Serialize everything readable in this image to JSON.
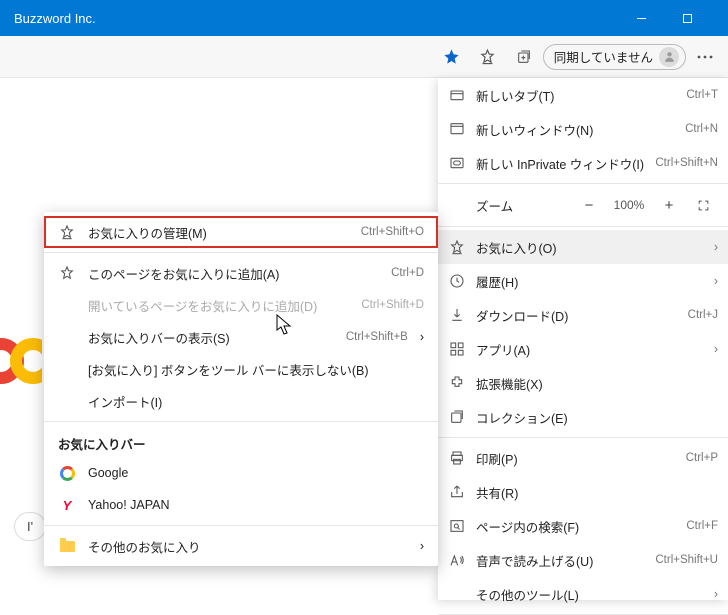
{
  "window": {
    "title": "Buzzword Inc."
  },
  "toolbar": {
    "sync_label": "同期していません"
  },
  "zoom": {
    "label": "ズーム",
    "value": "100%"
  },
  "menu": {
    "new_tab": {
      "label": "新しいタブ(T)",
      "shortcut": "Ctrl+T"
    },
    "new_window": {
      "label": "新しいウィンドウ(N)",
      "shortcut": "Ctrl+N"
    },
    "new_inprivate": {
      "label": "新しい InPrivate ウィンドウ(I)",
      "shortcut": "Ctrl+Shift+N"
    },
    "favorites": {
      "label": "お気に入り(O)"
    },
    "history": {
      "label": "履歴(H)"
    },
    "downloads": {
      "label": "ダウンロード(D)",
      "shortcut": "Ctrl+J"
    },
    "apps": {
      "label": "アプリ(A)"
    },
    "extensions": {
      "label": "拡張機能(X)"
    },
    "collections": {
      "label": "コレクション(E)"
    },
    "print": {
      "label": "印刷(P)",
      "shortcut": "Ctrl+P"
    },
    "share": {
      "label": "共有(R)"
    },
    "find": {
      "label": "ページ内の検索(F)",
      "shortcut": "Ctrl+F"
    },
    "read_aloud": {
      "label": "音声で読み上げる(U)",
      "shortcut": "Ctrl+Shift+U"
    },
    "more_tools": {
      "label": "その他のツール(L)"
    }
  },
  "fav_submenu": {
    "manage": {
      "label": "お気に入りの管理(M)",
      "shortcut": "Ctrl+Shift+O"
    },
    "add_page": {
      "label": "このページをお気に入りに追加(A)",
      "shortcut": "Ctrl+D"
    },
    "add_open": {
      "label": "開いているページをお気に入りに追加(D)",
      "shortcut": "Ctrl+Shift+D"
    },
    "show_bar": {
      "label": "お気に入りバーの表示(S)",
      "shortcut": "Ctrl+Shift+B"
    },
    "hide_btn": {
      "label": "[お気に入り] ボタンをツール バーに表示しない(B)"
    },
    "import": {
      "label": "インポート(I)"
    },
    "bar_header": "お気に入りバー",
    "google": "Google",
    "yahoo": "Yahoo! JAPAN",
    "other": "その他のお気に入り"
  },
  "chip": "I'"
}
